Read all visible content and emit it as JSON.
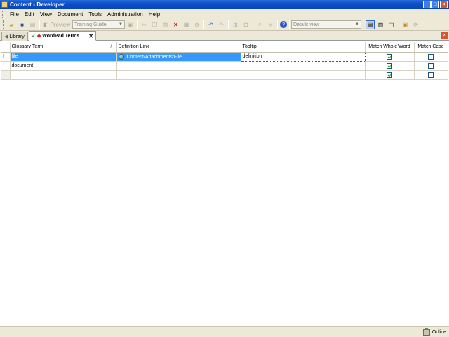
{
  "window": {
    "title": "Content - Developer"
  },
  "menu": [
    "File",
    "Edit",
    "View",
    "Document",
    "Tools",
    "Administration",
    "Help"
  ],
  "toolbar": {
    "preview_label": "Preview",
    "project_combo": "Training Guide",
    "view_combo": "Details view"
  },
  "tabs": [
    {
      "label": "Library"
    },
    {
      "label": "WordPad Terms"
    }
  ],
  "grid": {
    "columns": [
      "Glossary Term",
      "Definition Link",
      "Tooltip",
      "Match Whole Word",
      "Match Case"
    ],
    "rows": [
      {
        "term": "file",
        "link": "/Content/Attachments/File",
        "tooltip": "definition",
        "match_whole_word": true,
        "match_case": false,
        "selected": true
      },
      {
        "term": "document",
        "link": "",
        "tooltip": "",
        "match_whole_word": true,
        "match_case": false,
        "selected": false
      },
      {
        "term": "",
        "link": "",
        "tooltip": "",
        "match_whole_word": true,
        "match_case": false,
        "selected": false
      }
    ]
  },
  "status": {
    "text": "Online"
  },
  "colors": {
    "titlebar": "#0a4fc9",
    "selection": "#3399ff",
    "chrome": "#ece9d8"
  }
}
